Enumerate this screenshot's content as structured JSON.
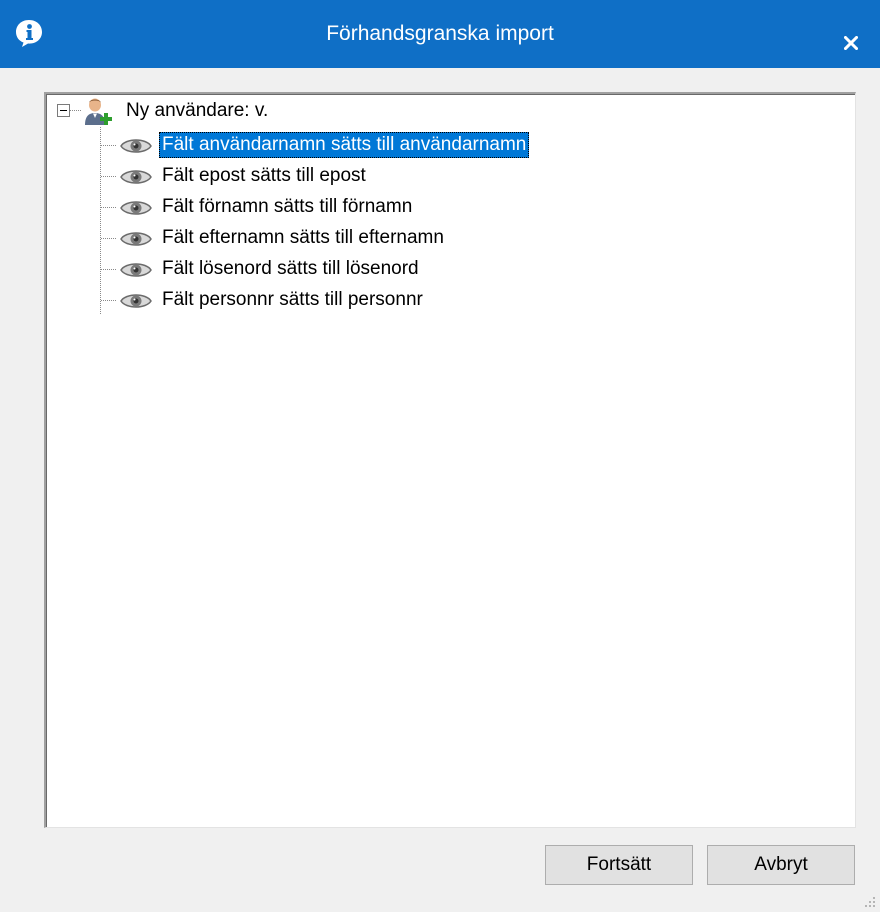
{
  "window": {
    "title": "Förhandsgranska import",
    "titlebar_color": "#0f6fc6",
    "icon": "info-icon",
    "close_glyph": "×"
  },
  "tree": {
    "root": {
      "label": "Ny användare: v.",
      "icon": "add-user-icon",
      "expanded": true
    },
    "children": [
      {
        "label": "Fält användarnamn sätts till användarnamn",
        "icon": "eye-icon",
        "selected": true
      },
      {
        "label": "Fält epost sätts till epost",
        "icon": "eye-icon",
        "selected": false
      },
      {
        "label": "Fält förnamn sätts till förnamn",
        "icon": "eye-icon",
        "selected": false
      },
      {
        "label": "Fält efternamn sätts till efternamn",
        "icon": "eye-icon",
        "selected": false
      },
      {
        "label": "Fält lösenord sätts till lösenord",
        "icon": "eye-icon",
        "selected": false
      },
      {
        "label": "Fält personnr sätts till personnr",
        "icon": "eye-icon",
        "selected": false
      }
    ],
    "selection_color": "#0078d7"
  },
  "buttons": {
    "continue_label": "Fortsätt",
    "cancel_label": "Avbryt"
  }
}
